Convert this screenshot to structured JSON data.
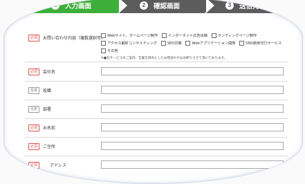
{
  "steps": [
    {
      "num": "1",
      "label": "入力画面"
    },
    {
      "num": "2",
      "label": "確認画面"
    },
    {
      "num": "3",
      "label": "送信完了"
    }
  ],
  "badges": {
    "required": "必須",
    "optional": "任意"
  },
  "inquiry": {
    "label": "お問い合わせ内容（複数選択可）",
    "options": [
      "Webサイト、ホームページ制作",
      "インターネット広告出稿",
      "ランディングページ制作",
      "アクセス解析コンサルティング",
      "SEO対策",
      "Webアプリケーション開発",
      "SNS運用代行サービス",
      "その他"
    ],
    "note": "※■社サービスのご案内、営業を目的としたお問合わせはお断りさせて頂いております。"
  },
  "fields": [
    {
      "label": "会社名",
      "badge": "必須",
      "value": ""
    },
    {
      "label": "役職",
      "badge": "任意",
      "value": ""
    },
    {
      "label": "部署",
      "badge": "任意",
      "value": ""
    },
    {
      "label": "お名前",
      "badge": "必須",
      "value": ""
    },
    {
      "label": "ご住所",
      "badge": "必須",
      "value": ""
    },
    {
      "label": "アドレス",
      "badge": "必須",
      "value": ""
    }
  ]
}
